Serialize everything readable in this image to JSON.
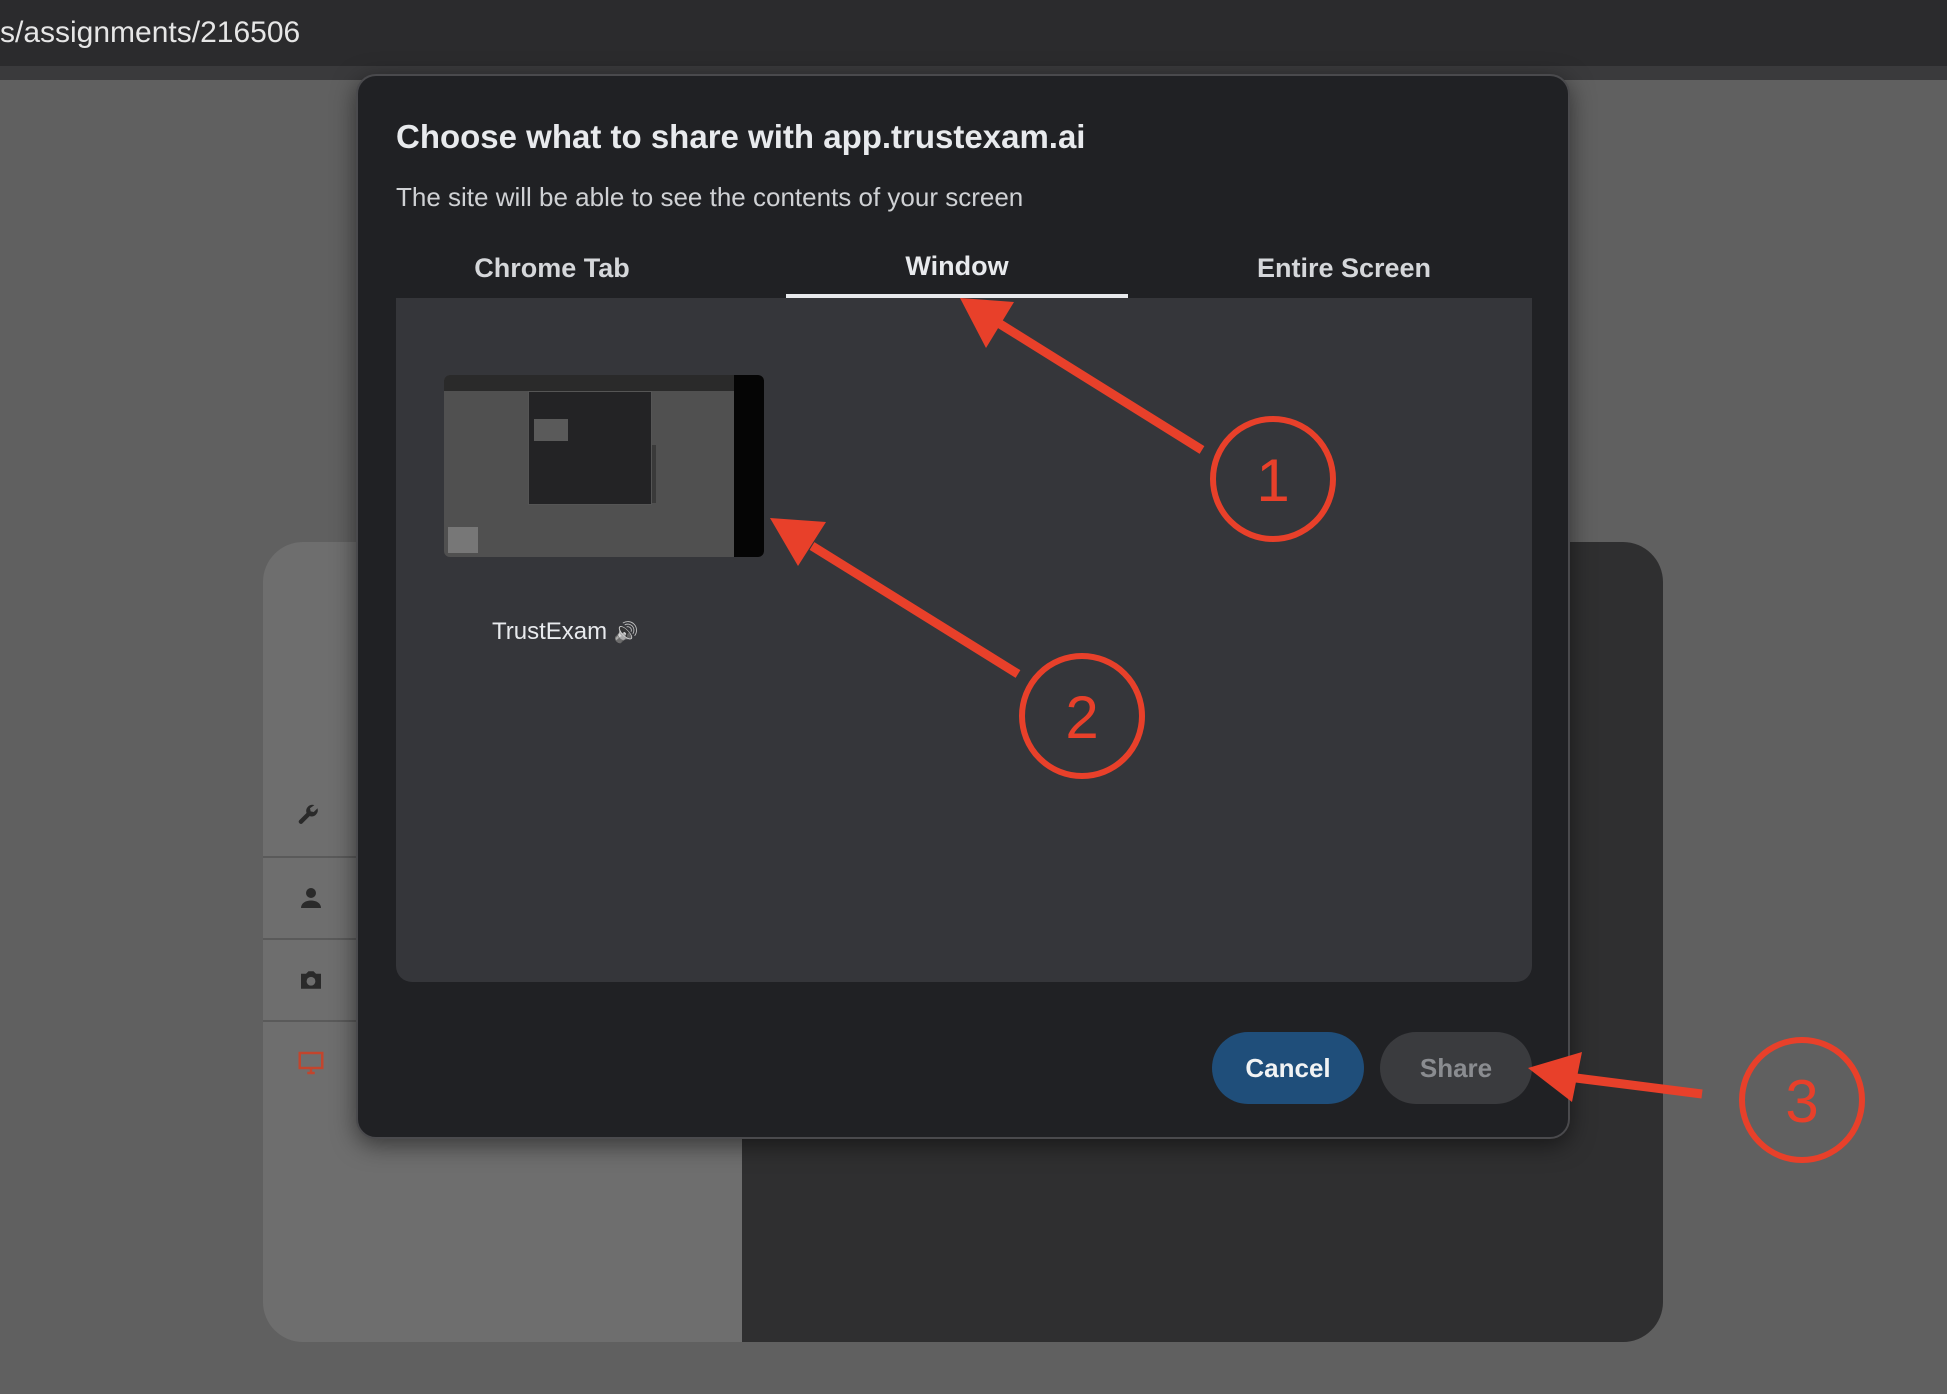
{
  "url_bar": {
    "text": "s/assignments/216506"
  },
  "dialog": {
    "title": "Choose what to share with app.trustexam.ai",
    "subtitle": "The site will be able to see the contents of your screen",
    "tabs": [
      {
        "label": "Chrome Tab",
        "active": false
      },
      {
        "label": "Window",
        "active": true
      },
      {
        "label": "Entire Screen",
        "active": false
      }
    ],
    "window_item": {
      "label": "TrustExam",
      "audio_icon": "🔊"
    },
    "buttons": {
      "cancel": "Cancel",
      "share": "Share"
    }
  },
  "background_sidebar": {
    "icons": [
      "wrench-icon",
      "person-icon",
      "camera-icon",
      "monitor-icon"
    ]
  },
  "annotations": {
    "markers": [
      "1",
      "2",
      "3"
    ],
    "color": "#e8402a"
  },
  "colors": {
    "dialog_bg": "#202124",
    "panel_bg": "#35363a",
    "primary_button": "#1f4e7a",
    "disabled_button": "#3a3b3e",
    "annotation": "#e8402a",
    "monitor_icon": "#c2452d"
  }
}
